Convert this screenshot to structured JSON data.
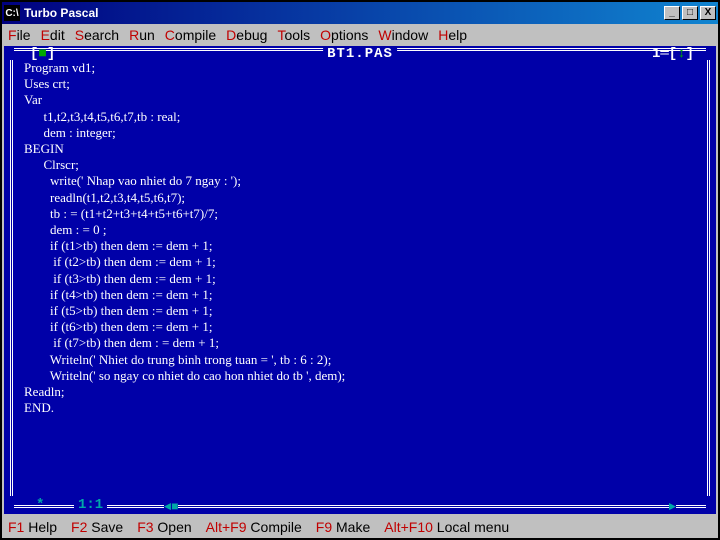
{
  "titlebar": {
    "app_icon_text": "C:\\",
    "title": "Turbo Pascal"
  },
  "menu": {
    "file": "File",
    "file_hk": "F",
    "edit": "Edit",
    "edit_hk": "E",
    "search": "Search",
    "search_hk": "S",
    "run": "Run",
    "run_hk": "R",
    "compile": "Compile",
    "compile_hk": "C",
    "debug": "Debug",
    "debug_hk": "D",
    "tools": "Tools",
    "tools_hk": "T",
    "options": "Options",
    "options_hk": "O",
    "window": "Window",
    "window_hk": "W",
    "help": "Help",
    "help_hk": "H"
  },
  "editor": {
    "close_box": "[■]",
    "filename": "BT1.PAS",
    "zoom_box": "1═[↕]",
    "cursor_pos": "1:1",
    "modified_star": "*",
    "scroll_left": "◄■",
    "scroll_right": "►",
    "lines": [
      "Program vd1;",
      "Uses crt;",
      "Var",
      "      t1,t2,t3,t4,t5,t6,t7,tb : real;",
      "      dem : integer;",
      "BEGIN",
      "      Clrscr;",
      "        write(' Nhap vao nhiet do 7 ngay : ');",
      "        readln(t1,t2,t3,t4,t5,t6,t7);",
      "        tb : = (t1+t2+t3+t4+t5+t6+t7)/7;",
      "        dem : = 0 ;",
      "        if (t1>tb) then dem := dem + 1;",
      "         if (t2>tb) then dem := dem + 1;",
      "         if (t3>tb) then dem := dem + 1;",
      "        if (t4>tb) then dem := dem + 1;",
      "        if (t5>tb) then dem := dem + 1;",
      "        if (t6>tb) then dem := dem + 1;",
      "         if (t7>tb) then dem : = dem + 1;",
      "        Writeln(' Nhiet do trung binh trong tuan = ', tb : 6 : 2);",
      "        Writeln(' so ngay co nhiet do cao hon nhiet do tb ', dem);",
      "Readln;",
      "END."
    ]
  },
  "status": {
    "f1_key": "F1",
    "f1_label": "Help",
    "f2_key": "F2",
    "f2_label": "Save",
    "f3_key": "F3",
    "f3_label": "Open",
    "af9_key": "Alt+F9",
    "af9_label": "Compile",
    "f9_key": "F9",
    "f9_label": "Make",
    "af10_key": "Alt+F10",
    "af10_label": "Local menu"
  }
}
